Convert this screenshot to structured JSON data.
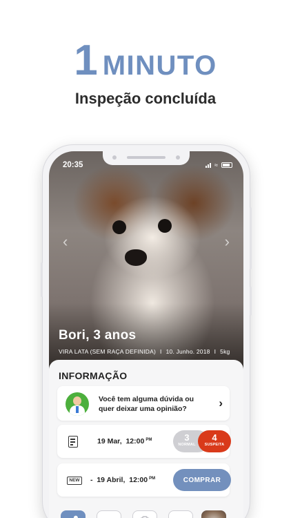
{
  "header": {
    "number": "1",
    "word": "MINUTO",
    "subtitle": "Inspeção concluída"
  },
  "status_bar": {
    "time": "20:35"
  },
  "pet": {
    "name": "Bori, 3 anos",
    "breed": "VIRA LATA (SEM RAÇA DEFINIDA)",
    "birth_date": "10. Junho. 2018",
    "weight": "5kg",
    "separator": "I"
  },
  "info": {
    "title": "INFORMAÇÃO",
    "vet_card": {
      "line1": "Você tem alguma dúvida ou",
      "line2": "quer deixar uma opinião?"
    },
    "inspection": {
      "date": "19 Mar,",
      "time": "12:00",
      "period": "PM",
      "normal_count": "3",
      "normal_label": "NORMAL",
      "suspect_count": "4",
      "suspect_label": "SUSPEITA"
    },
    "new_inspection": {
      "badge": "NEW",
      "prefix": "-",
      "date": "19 Abril,",
      "time": "12:00",
      "period": "PM",
      "button": "COMPRAR"
    }
  },
  "icons": {
    "prev": "chevron-left-icon",
    "next": "chevron-right-icon",
    "vet": "veterinarian-avatar-icon",
    "report": "document-list-icon",
    "tab_home": "bone-icon",
    "tab_camera": "camera-icon",
    "tab_clipboard": "clipboard-icon"
  },
  "colors": {
    "accent": "#6f8fbf",
    "suspect": "#d93a1a",
    "normal": "#cfcfd3",
    "button": "#7390bd"
  }
}
